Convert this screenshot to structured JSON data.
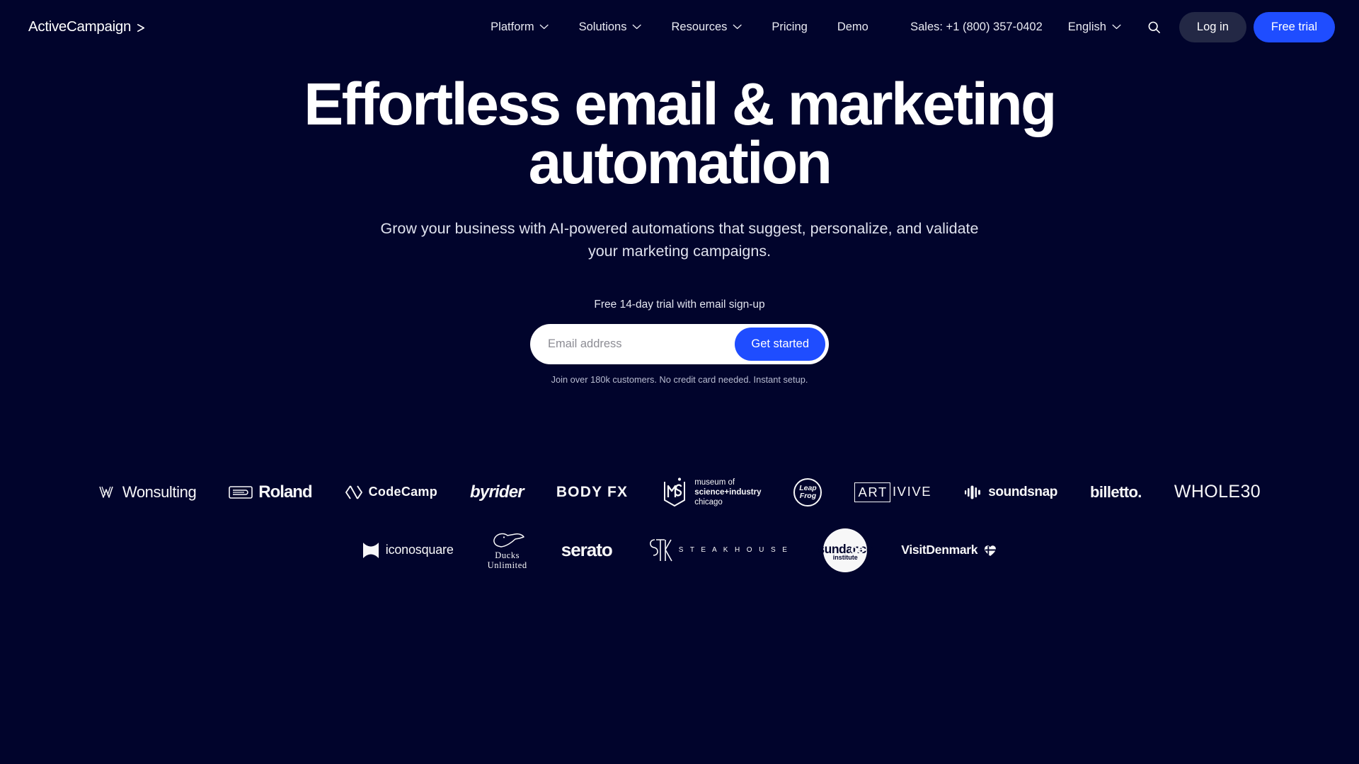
{
  "brand": {
    "name": "ActiveCampaign",
    "chevron_icon": "chevron-right-icon"
  },
  "colors": {
    "background": "#01042c",
    "accent_blue": "#1f4dff",
    "login_pill": "#232845",
    "text_primary": "#ffffff",
    "text_muted": "#b9bdd2"
  },
  "nav": {
    "items": [
      {
        "label": "Platform",
        "has_dropdown": true,
        "icon": "chevron-down-icon"
      },
      {
        "label": "Solutions",
        "has_dropdown": true,
        "icon": "chevron-down-icon"
      },
      {
        "label": "Resources",
        "has_dropdown": true,
        "icon": "chevron-down-icon"
      },
      {
        "label": "Pricing",
        "has_dropdown": false,
        "icon": ""
      },
      {
        "label": "Demo",
        "has_dropdown": false,
        "icon": ""
      }
    ],
    "sales_label": "Sales: +1 (800) 357-0402",
    "language": "English",
    "language_icon": "chevron-down-icon",
    "search_icon": "search-icon",
    "login_label": "Log in",
    "free_trial_label": "Free trial"
  },
  "hero": {
    "heading": "Effortless email & marketing automation",
    "subheading": "Grow your business with AI-powered automations that suggest, personalize, and validate your marketing campaigns.",
    "trial_note": "Free 14-day trial with email sign-up",
    "email_placeholder": "Email address",
    "email_value": "",
    "cta_label": "Get started",
    "join_note": "Join over 180k customers. No credit card needed. Instant setup."
  },
  "logos": {
    "row1": [
      {
        "name": "Wonsulting"
      },
      {
        "name": "Roland"
      },
      {
        "name": "CodeCamp"
      },
      {
        "name": "byrider"
      },
      {
        "name": "BODY FX"
      },
      {
        "name": "museum of science+industry chicago",
        "line1": "museum of",
        "line2": "science+industry",
        "line3": "chicago"
      },
      {
        "name": "Leap Frog",
        "line1": "Leap",
        "line2": "Frog"
      },
      {
        "name": "ARTIVIVE",
        "part1": "ART",
        "part2": "IVIVE"
      },
      {
        "name": "soundsnap"
      },
      {
        "name": "billetto."
      },
      {
        "name": "WHOLE30"
      }
    ],
    "row2": [
      {
        "name": "iconosquare"
      },
      {
        "name": "Ducks Unlimited",
        "line1": "Ducks",
        "line2": "Unlimited"
      },
      {
        "name": "serato"
      },
      {
        "name": "STK STEAKHOUSE",
        "mark": "STK",
        "word": "S T E A K H O U S E"
      },
      {
        "name": "sundance institute",
        "line1": "sundance",
        "line2": "institute"
      },
      {
        "name": "VisitDenmark"
      }
    ]
  }
}
